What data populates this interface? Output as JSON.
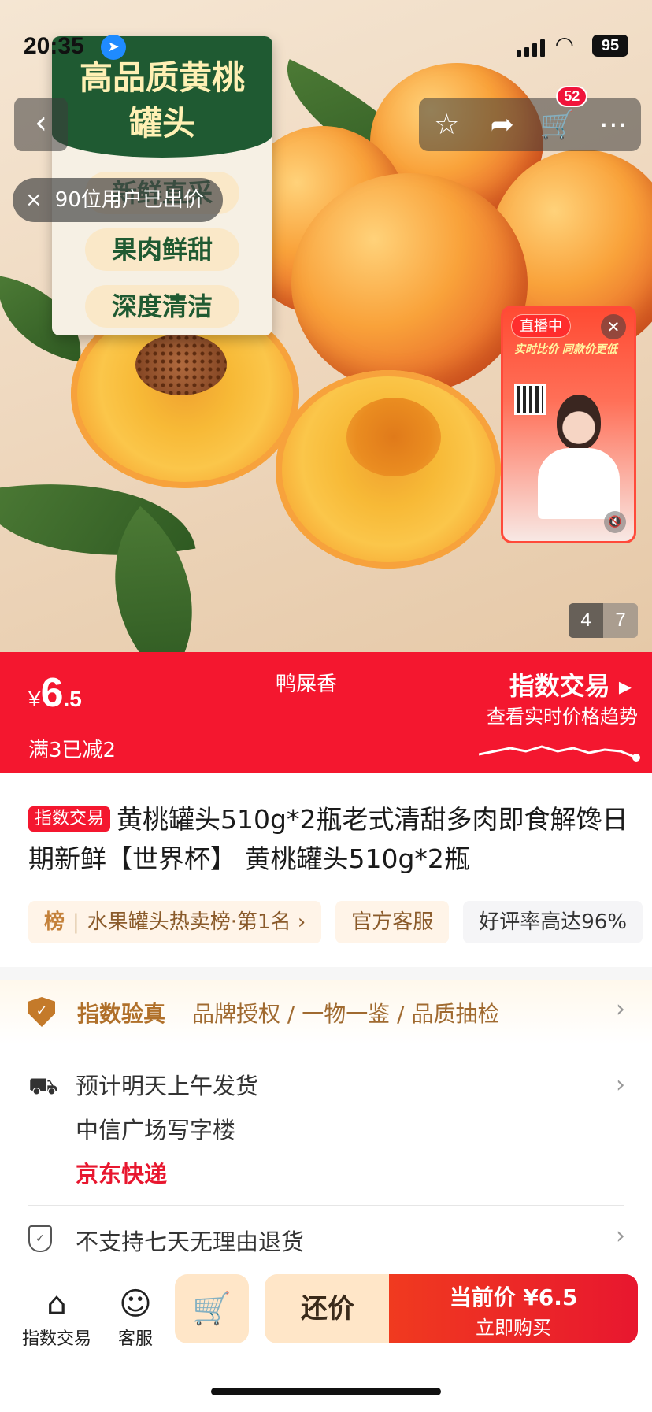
{
  "status_bar": {
    "time": "20:35",
    "battery": "95"
  },
  "nav": {
    "back_icon": "‹",
    "cart_badge": "52"
  },
  "promo": {
    "title_line1": "高品质黄桃",
    "title_line2": "罐头",
    "pills": [
      "新鲜直采",
      "果肉鲜甜",
      "深度清洁"
    ]
  },
  "bid_toast": {
    "close": "×",
    "text": "90位用户已出价"
  },
  "live": {
    "tag": "直播中",
    "banner": "实时比价 同款价更低"
  },
  "image_counter": {
    "current": "4",
    "total": "7"
  },
  "price_bar": {
    "currency": "¥",
    "price_int": "6",
    "price_dec": ".5",
    "coupon": "满3已减2",
    "seller": "鸭屎香",
    "index_title": "指数交易 ▸",
    "index_sub": "查看实时价格趋势"
  },
  "product": {
    "tag": "指数交易",
    "title": "黄桃罐头510g*2瓶老式清甜多肉即食解馋日期新鲜【世界杯】 黄桃罐头510g*2瓶"
  },
  "chips": {
    "rank_label": "榜",
    "rank_text": "水果罐头热卖榜·第1名 ›",
    "service": "官方客服",
    "rating": "好评率高达96%"
  },
  "verify": {
    "title": "指数验真",
    "desc": "品牌授权 / 一物一鉴 / 品质抽检"
  },
  "delivery": {
    "line1": "预计明天上午发货",
    "line2": "中信广场写字楼",
    "carrier": "京东快递"
  },
  "returns": {
    "text": "不支持七天无理由退货"
  },
  "bottom_bar": {
    "tab1_label": "指数交易",
    "tab2_label": "客服",
    "haggle": "还价",
    "buy_line1": "当前价 ¥6.5",
    "buy_line2": "立即购买"
  },
  "colors": {
    "accent_red": "#f4172f",
    "brand_gold": "#c47a2a"
  }
}
